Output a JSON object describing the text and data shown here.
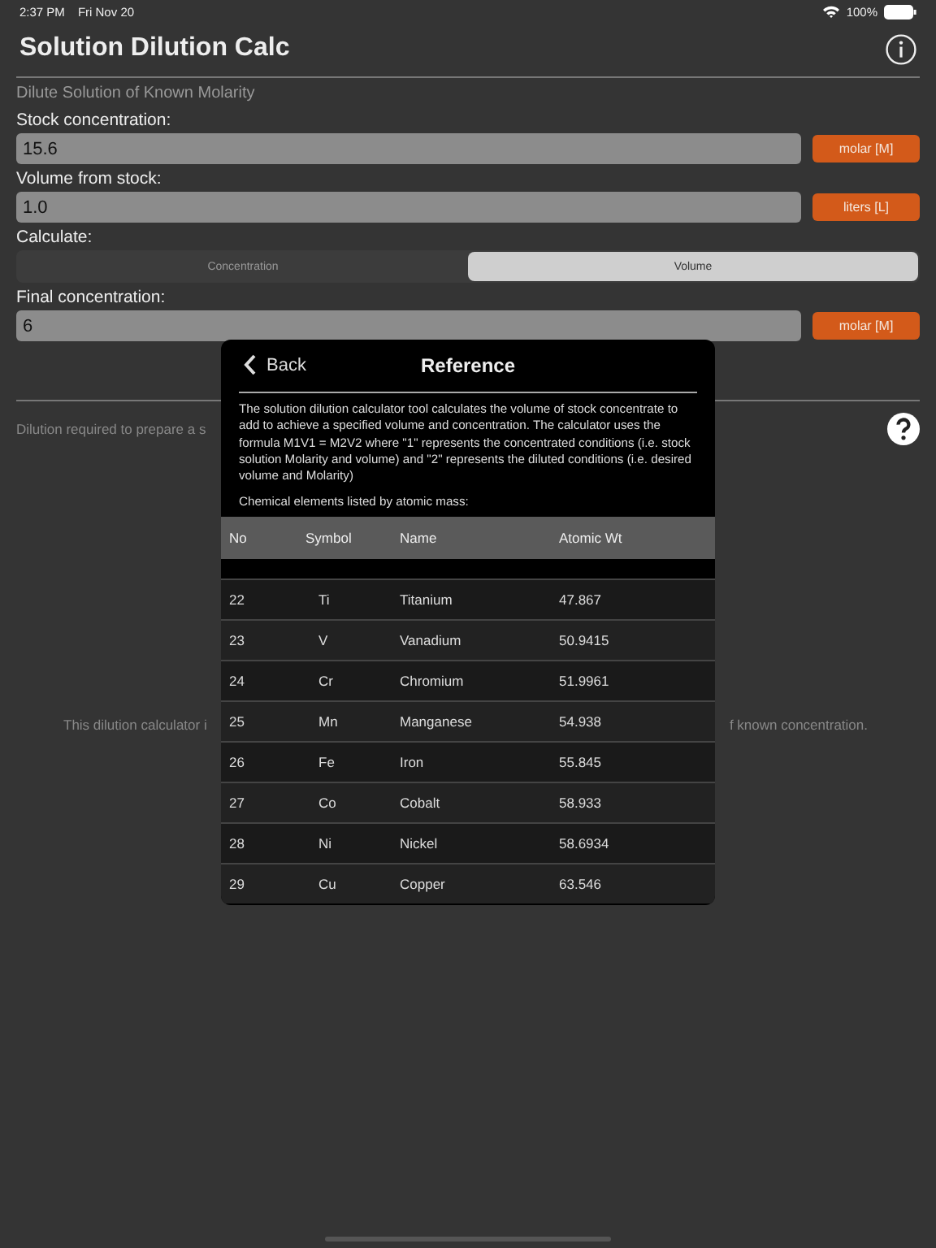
{
  "status_bar": {
    "time": "2:37 PM",
    "date": "Fri Nov 20",
    "battery": "100%"
  },
  "title": "Solution Dilution Calc",
  "subtitle": "Dilute Solution of Known Molarity",
  "fields": [
    {
      "label": "Stock concentration:",
      "value": "15.6",
      "unit": "molar [M]"
    },
    {
      "label": "Volume from stock:",
      "value": "1.0",
      "unit": "liters [L]"
    }
  ],
  "calculate": {
    "label": "Calculate:",
    "options": [
      {
        "label": "Concentration",
        "selected": false
      },
      {
        "label": "Volume",
        "selected": true
      }
    ]
  },
  "final": {
    "label": "Final concentration:",
    "value": "6",
    "unit": "molar [M]"
  },
  "result_text": "Dilution required to prepare a s",
  "info_text_left": "This dilution calculator i",
  "info_text_right": "f known concentration.",
  "modal": {
    "back": "Back",
    "title": "Reference",
    "description": "The solution dilution calculator tool calculates the volume of stock concentrate to add to achieve a specified volume and concentration. The calculator uses the formula M1V1 = M2V2 where \"1\" represents the concentrated conditions (i.e. stock solution Molarity and volume) and \"2\" represents the diluted conditions (i.e. desired volume and Molarity)",
    "list_caption": "Chemical elements listed by atomic mass:",
    "columns": [
      "No",
      "Symbol",
      "Name",
      "Atomic Wt"
    ],
    "rows": [
      [
        "22",
        "Ti",
        "Titanium",
        "47.867"
      ],
      [
        "23",
        "V",
        "Vanadium",
        "50.9415"
      ],
      [
        "24",
        "Cr",
        "Chromium",
        "51.9961"
      ],
      [
        "25",
        "Mn",
        "Manganese",
        "54.938"
      ],
      [
        "26",
        "Fe",
        "Iron",
        "55.845"
      ],
      [
        "27",
        "Co",
        "Cobalt",
        "58.933"
      ],
      [
        "28",
        "Ni",
        "Nickel",
        "58.6934"
      ],
      [
        "29",
        "Cu",
        "Copper",
        "63.546"
      ]
    ]
  }
}
